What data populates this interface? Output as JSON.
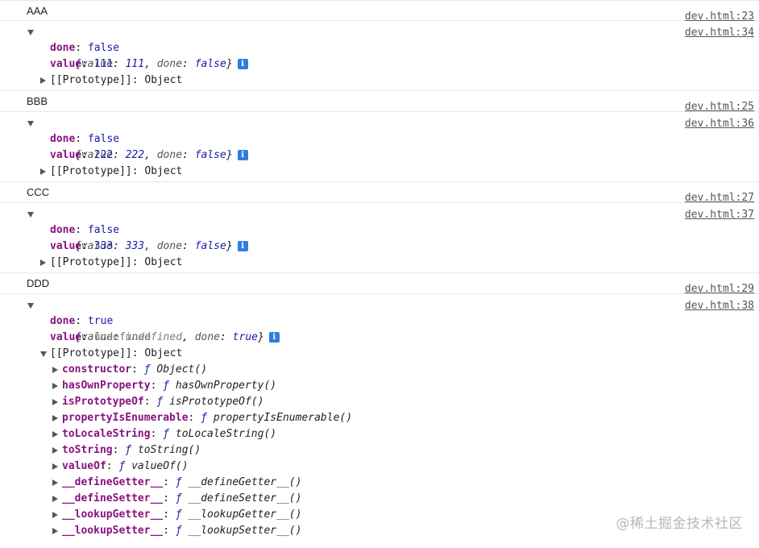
{
  "logs": [
    {
      "text": "AAA",
      "source": "dev.html:23"
    },
    {
      "source": "dev.html:34",
      "summary": {
        "open": "{",
        "k1": "value",
        "v1": "111",
        "k2": "done",
        "v2": "false",
        "close": "}"
      },
      "props": [
        {
          "name": "done",
          "value": "false"
        },
        {
          "name": "value",
          "value": "111"
        }
      ],
      "prototype": "[[Prototype]]: Object"
    },
    {
      "text": "BBB",
      "source": "dev.html:25"
    },
    {
      "source": "dev.html:36",
      "summary": {
        "open": "{",
        "k1": "value",
        "v1": "222",
        "k2": "done",
        "v2": "false",
        "close": "}"
      },
      "props": [
        {
          "name": "done",
          "value": "false"
        },
        {
          "name": "value",
          "value": "222"
        }
      ],
      "prototype": "[[Prototype]]: Object"
    },
    {
      "text": "CCC",
      "source": "dev.html:27"
    },
    {
      "source": "dev.html:37",
      "summary": {
        "open": "{",
        "k1": "value",
        "v1": "333",
        "k2": "done",
        "v2": "false",
        "close": "}"
      },
      "props": [
        {
          "name": "done",
          "value": "false"
        },
        {
          "name": "value",
          "value": "333"
        }
      ],
      "prototype": "[[Prototype]]: Object"
    },
    {
      "text": "DDD",
      "source": "dev.html:29"
    },
    {
      "source": "dev.html:38",
      "summary": {
        "open": "{",
        "k1": "value",
        "v1": "undefined",
        "k2": "done",
        "v2": "true",
        "close": "}"
      },
      "props": [
        {
          "name": "done",
          "value": "true"
        },
        {
          "name": "value",
          "value": "undefined"
        }
      ],
      "prototype": "[[Prototype]]: Object",
      "proto_members": [
        {
          "name": "constructor",
          "sig": "Object()"
        },
        {
          "name": "hasOwnProperty",
          "sig": "hasOwnProperty()"
        },
        {
          "name": "isPrototypeOf",
          "sig": "isPrototypeOf()"
        },
        {
          "name": "propertyIsEnumerable",
          "sig": "propertyIsEnumerable()"
        },
        {
          "name": "toLocaleString",
          "sig": "toLocaleString()"
        },
        {
          "name": "toString",
          "sig": "toString()"
        },
        {
          "name": "valueOf",
          "sig": "valueOf()"
        },
        {
          "name": "__defineGetter__",
          "sig": "__defineGetter__()"
        },
        {
          "name": "__defineSetter__",
          "sig": "__defineSetter__()"
        },
        {
          "name": "__lookupGetter__",
          "sig": "__lookupGetter__()"
        },
        {
          "name": "__lookupSetter__",
          "sig": "__lookupSetter__()"
        }
      ]
    }
  ],
  "info_glyph": "i",
  "func_symbol": "ƒ",
  "watermark": "@稀土掘金技术社区",
  "colors": {
    "prop_name": "#881280",
    "value": "#1a1aa6",
    "info": "#2f7de1"
  }
}
